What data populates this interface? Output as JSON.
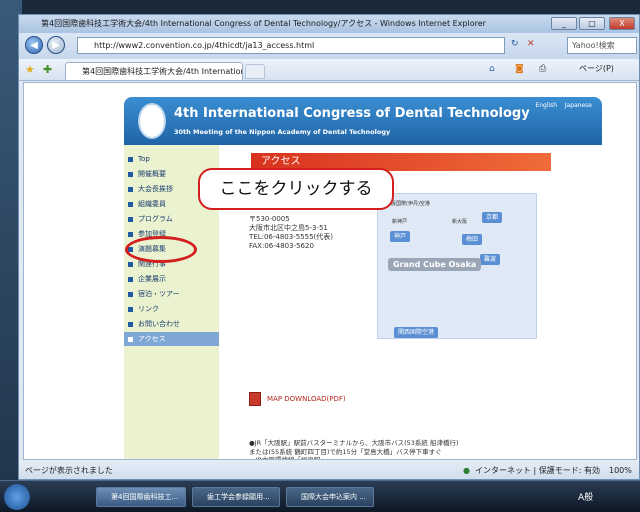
{
  "window": {
    "title": "第4回国際歯科技工学術大会/4th International Congress of Dental Technology/アクセス - Windows Internet Explorer",
    "minimize": "_",
    "maximize": "□",
    "close": "X"
  },
  "address": {
    "url": "http://www2.convention.co.jp/4thicdt/ja13_access.html",
    "search_placeholder": "Yahoo!検索",
    "back_icon": "back-arrow-icon",
    "forward_icon": "forward-arrow-icon"
  },
  "tabs": {
    "active_label": "第4回国際歯科技工学術大会/4th International...",
    "page_menu": "ページ(P)"
  },
  "page": {
    "header_title": "4th International Congress of Dental Technology",
    "header_subtitle": "30th Meeting of the Nippon Academy of Dental Technology",
    "lang_english": "English",
    "lang_japanese": "Japanese",
    "nav": [
      "Top",
      "開催概要",
      "大会長挨拶",
      "組織委員",
      "プログラム",
      "参加登録",
      "演題募集",
      "関連行事",
      "企業展示",
      "宿泊・ツアー",
      "リンク",
      "お問い合わせ",
      "アクセス"
    ],
    "access_title": "アクセス",
    "address_block": "〒530-0005\n大阪市北区中之島5-3-51\nTEL:06-4803-5555(代表)\nFAX:06-4803-5620",
    "map": {
      "airport": "大阪国際(伊丹)空港",
      "kyoto": "京都",
      "shinkobe_small": "新神戸",
      "shinosaka_small": "新大阪",
      "kobe": "神戸",
      "umeda": "梅田",
      "namba": "難波",
      "venue": "Grand Cube Osaka",
      "kix": "関西国際空港"
    },
    "map_download": "MAP DOWNLOAD(PDF)",
    "access_text": "●JR「大阪駅」駅前バスターミナルから、大阪市バス(53系統 船津橋行)\nまたは(55系統 鶴町四丁目)で約15分「堂島大橋」バス停下車すぐ\n・JR大阪環状線「福島駅」\n・JR東西線「新福島駅」(2番出口)\n・阪神電鉄「福島駅」\n・大阪市営地下鉄(中央線・千日前線)「阿波座」(中央線1号出口・千日前線9号出口)\n\n上記各駅よりそれぞれ徒歩約10分\n\n●シャトルバスが、「リーガロイヤルホテル」(当会議場東隣)と各ターミナル(JR「大阪駅」\n西側(高架下)、地下鉄・京阪「淀屋橋駅」西側)の間で運行しており、ご利用いただけます。"
  },
  "annotation": {
    "callout_text": "ここをクリックする"
  },
  "statusbar": {
    "status": "ページが表示されました",
    "zone": "インターネット | 保護モード: 有効",
    "zoom": "100%"
  },
  "taskbar": {
    "items": [
      "第4回国際歯科技工...",
      "歯工学会参録願用...",
      "国際大会申込案内 ..."
    ],
    "tray": "A般"
  }
}
